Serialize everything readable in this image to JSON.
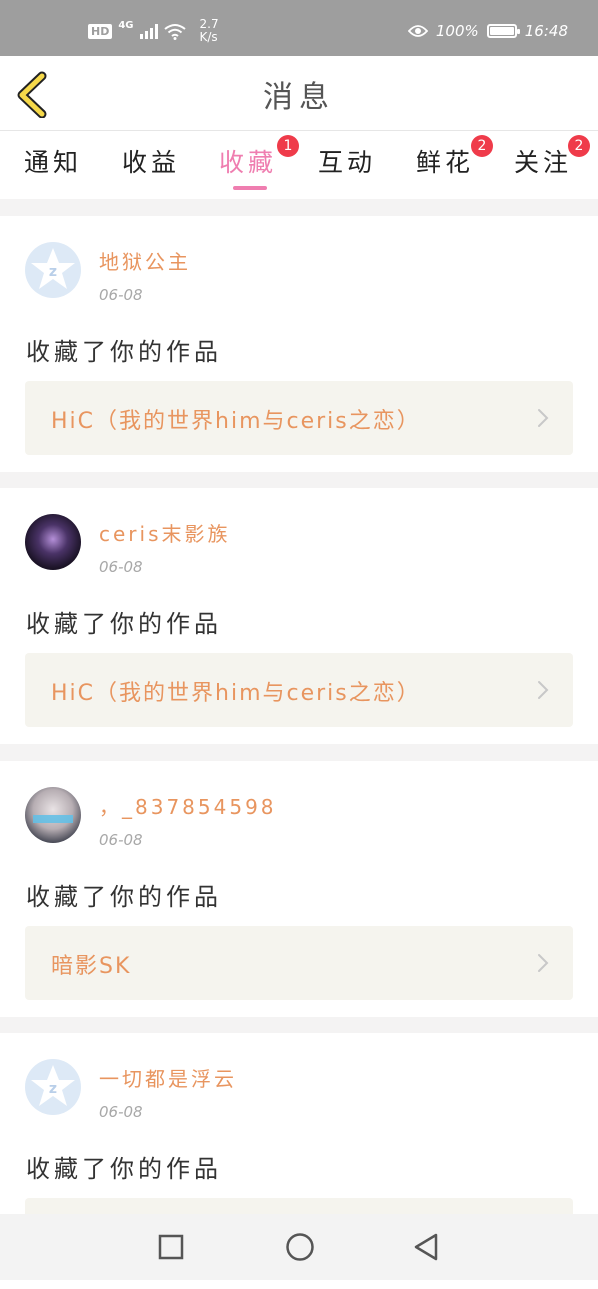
{
  "status_bar": {
    "hd": "HD",
    "network": "4G",
    "speed_value": "2.7",
    "speed_unit": "K/s",
    "battery": "100%",
    "time": "16:48"
  },
  "header": {
    "title": "消息"
  },
  "tabs": [
    {
      "label": "通知",
      "badge": null,
      "active": false
    },
    {
      "label": "收益",
      "badge": null,
      "active": false
    },
    {
      "label": "收藏",
      "badge": "1",
      "active": true
    },
    {
      "label": "互动",
      "badge": null,
      "active": false
    },
    {
      "label": "鲜花",
      "badge": "2",
      "active": false
    },
    {
      "label": "关注",
      "badge": "2",
      "active": false
    }
  ],
  "items": [
    {
      "username": "地狱公主",
      "date": "06-08",
      "action": "收藏了你的作品",
      "work": "HiC（我的世界him与ceris之恋）",
      "avatar": "default-avatar"
    },
    {
      "username": "ceris末影族",
      "date": "06-08",
      "action": "收藏了你的作品",
      "work": "HiC（我的世界him与ceris之恋）",
      "avatar": "dark-avatar"
    },
    {
      "username": "，_837854598",
      "date": "06-08",
      "action": "收藏了你的作品",
      "work": "暗影SK",
      "avatar": "photo-avatar"
    },
    {
      "username": "一切都是浮云",
      "date": "06-08",
      "action": "收藏了你的作品",
      "work": "",
      "avatar": "default-avatar"
    }
  ],
  "colors": {
    "accent_pink": "#ef7eb0",
    "username_orange": "#e8955f",
    "badge_red": "#ef3b4a",
    "status_bar_bg": "#9e9e9e"
  },
  "icons": {
    "back": "chevron-left-icon",
    "nav_recent": "square-icon",
    "nav_home": "circle-icon",
    "nav_back": "triangle-back-icon"
  }
}
